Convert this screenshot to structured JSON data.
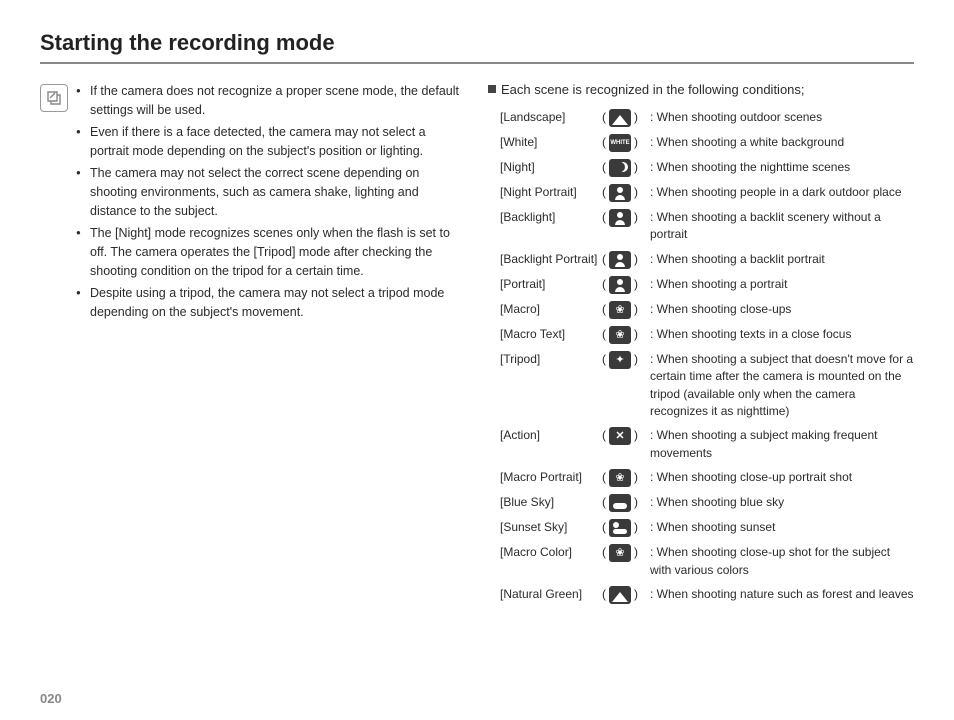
{
  "title": "Starting the recording mode",
  "page_number": "020",
  "notes": [
    "If the camera does not recognize a proper scene mode, the default settings will be used.",
    "Even if there is a face detected, the camera may not select a portrait mode depending on the subject's position or lighting.",
    "The camera may not select the correct scene depending on shooting environments, such as camera shake, lighting and distance to the subject.",
    "The [Night] mode recognizes scenes only when the flash is set to off. The camera operates the [Tripod] mode after checking the shooting condition on the tripod for a certain time.",
    "Despite using a tripod, the camera may not select a tripod mode depending on the subject's movement."
  ],
  "scene_intro": "Each scene is recognized in the following conditions;",
  "scenes": [
    {
      "name": "[Landscape]",
      "icon": "landscape-icon",
      "cls": "i-landscape",
      "desc": ": When shooting outdoor scenes"
    },
    {
      "name": "[White]",
      "icon": "white-icon",
      "cls": "i-white",
      "desc": ": When shooting a white background"
    },
    {
      "name": "[Night]",
      "icon": "night-icon",
      "cls": "i-night",
      "desc": ": When shooting the nighttime scenes"
    },
    {
      "name": "[Night Portrait]",
      "icon": "night-portrait-icon",
      "cls": "i-portrait",
      "desc": ": When shooting people in a dark outdoor place"
    },
    {
      "name": "[Backlight]",
      "icon": "backlight-icon",
      "cls": "i-portrait",
      "desc": ": When shooting a backlit scenery without a portrait"
    },
    {
      "name": "[Backlight Portrait]",
      "icon": "backlight-portrait-icon",
      "cls": "i-portrait",
      "desc": ": When shooting a backlit portrait"
    },
    {
      "name": "[Portrait]",
      "icon": "portrait-icon",
      "cls": "i-portrait",
      "desc": ": When shooting a portrait"
    },
    {
      "name": "[Macro]",
      "icon": "macro-icon",
      "cls": "i-macro",
      "desc": ": When shooting close-ups"
    },
    {
      "name": "[Macro Text]",
      "icon": "macro-text-icon",
      "cls": "i-macro",
      "desc": ": When shooting texts in a close focus"
    },
    {
      "name": "[Tripod]",
      "icon": "tripod-icon",
      "cls": "i-tripod",
      "desc": ": When shooting a subject that doesn't move for a certain time after the camera is mounted on the tripod (available only when the camera recognizes it as nighttime)"
    },
    {
      "name": "[Action]",
      "icon": "action-icon",
      "cls": "i-action",
      "desc": ": When shooting a subject making frequent movements"
    },
    {
      "name": "[Macro Portrait]",
      "icon": "macro-portrait-icon",
      "cls": "i-macro",
      "desc": ": When shooting close-up portrait shot"
    },
    {
      "name": "[Blue Sky]",
      "icon": "blue-sky-icon",
      "cls": "i-sky",
      "desc": ": When shooting blue sky"
    },
    {
      "name": "[Sunset Sky]",
      "icon": "sunset-sky-icon",
      "cls": "i-sunset",
      "desc": ": When shooting sunset"
    },
    {
      "name": "[Macro Color]",
      "icon": "macro-color-icon",
      "cls": "i-macro",
      "desc": ": When shooting close-up shot for the subject with various colors"
    },
    {
      "name": "[Natural Green]",
      "icon": "natural-green-icon",
      "cls": "i-landscape",
      "desc": ": When shooting nature such as forest and leaves"
    }
  ],
  "white_label": "WHITE"
}
